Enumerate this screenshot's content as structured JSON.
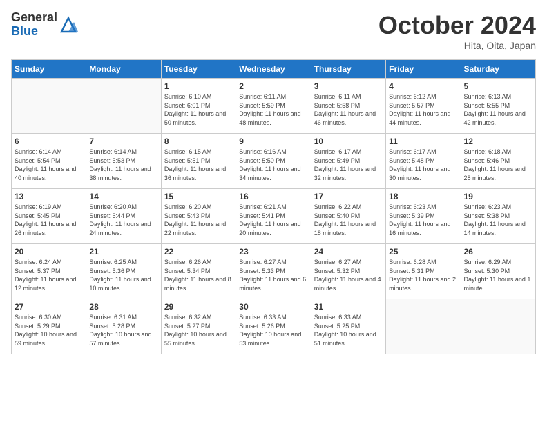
{
  "header": {
    "logo_general": "General",
    "logo_blue": "Blue",
    "month_title": "October 2024",
    "location": "Hita, Oita, Japan"
  },
  "days_of_week": [
    "Sunday",
    "Monday",
    "Tuesday",
    "Wednesday",
    "Thursday",
    "Friday",
    "Saturday"
  ],
  "weeks": [
    [
      {
        "day": "",
        "info": ""
      },
      {
        "day": "",
        "info": ""
      },
      {
        "day": "1",
        "info": "Sunrise: 6:10 AM\nSunset: 6:01 PM\nDaylight: 11 hours and 50 minutes."
      },
      {
        "day": "2",
        "info": "Sunrise: 6:11 AM\nSunset: 5:59 PM\nDaylight: 11 hours and 48 minutes."
      },
      {
        "day": "3",
        "info": "Sunrise: 6:11 AM\nSunset: 5:58 PM\nDaylight: 11 hours and 46 minutes."
      },
      {
        "day": "4",
        "info": "Sunrise: 6:12 AM\nSunset: 5:57 PM\nDaylight: 11 hours and 44 minutes."
      },
      {
        "day": "5",
        "info": "Sunrise: 6:13 AM\nSunset: 5:55 PM\nDaylight: 11 hours and 42 minutes."
      }
    ],
    [
      {
        "day": "6",
        "info": "Sunrise: 6:14 AM\nSunset: 5:54 PM\nDaylight: 11 hours and 40 minutes."
      },
      {
        "day": "7",
        "info": "Sunrise: 6:14 AM\nSunset: 5:53 PM\nDaylight: 11 hours and 38 minutes."
      },
      {
        "day": "8",
        "info": "Sunrise: 6:15 AM\nSunset: 5:51 PM\nDaylight: 11 hours and 36 minutes."
      },
      {
        "day": "9",
        "info": "Sunrise: 6:16 AM\nSunset: 5:50 PM\nDaylight: 11 hours and 34 minutes."
      },
      {
        "day": "10",
        "info": "Sunrise: 6:17 AM\nSunset: 5:49 PM\nDaylight: 11 hours and 32 minutes."
      },
      {
        "day": "11",
        "info": "Sunrise: 6:17 AM\nSunset: 5:48 PM\nDaylight: 11 hours and 30 minutes."
      },
      {
        "day": "12",
        "info": "Sunrise: 6:18 AM\nSunset: 5:46 PM\nDaylight: 11 hours and 28 minutes."
      }
    ],
    [
      {
        "day": "13",
        "info": "Sunrise: 6:19 AM\nSunset: 5:45 PM\nDaylight: 11 hours and 26 minutes."
      },
      {
        "day": "14",
        "info": "Sunrise: 6:20 AM\nSunset: 5:44 PM\nDaylight: 11 hours and 24 minutes."
      },
      {
        "day": "15",
        "info": "Sunrise: 6:20 AM\nSunset: 5:43 PM\nDaylight: 11 hours and 22 minutes."
      },
      {
        "day": "16",
        "info": "Sunrise: 6:21 AM\nSunset: 5:41 PM\nDaylight: 11 hours and 20 minutes."
      },
      {
        "day": "17",
        "info": "Sunrise: 6:22 AM\nSunset: 5:40 PM\nDaylight: 11 hours and 18 minutes."
      },
      {
        "day": "18",
        "info": "Sunrise: 6:23 AM\nSunset: 5:39 PM\nDaylight: 11 hours and 16 minutes."
      },
      {
        "day": "19",
        "info": "Sunrise: 6:23 AM\nSunset: 5:38 PM\nDaylight: 11 hours and 14 minutes."
      }
    ],
    [
      {
        "day": "20",
        "info": "Sunrise: 6:24 AM\nSunset: 5:37 PM\nDaylight: 11 hours and 12 minutes."
      },
      {
        "day": "21",
        "info": "Sunrise: 6:25 AM\nSunset: 5:36 PM\nDaylight: 11 hours and 10 minutes."
      },
      {
        "day": "22",
        "info": "Sunrise: 6:26 AM\nSunset: 5:34 PM\nDaylight: 11 hours and 8 minutes."
      },
      {
        "day": "23",
        "info": "Sunrise: 6:27 AM\nSunset: 5:33 PM\nDaylight: 11 hours and 6 minutes."
      },
      {
        "day": "24",
        "info": "Sunrise: 6:27 AM\nSunset: 5:32 PM\nDaylight: 11 hours and 4 minutes."
      },
      {
        "day": "25",
        "info": "Sunrise: 6:28 AM\nSunset: 5:31 PM\nDaylight: 11 hours and 2 minutes."
      },
      {
        "day": "26",
        "info": "Sunrise: 6:29 AM\nSunset: 5:30 PM\nDaylight: 11 hours and 1 minute."
      }
    ],
    [
      {
        "day": "27",
        "info": "Sunrise: 6:30 AM\nSunset: 5:29 PM\nDaylight: 10 hours and 59 minutes."
      },
      {
        "day": "28",
        "info": "Sunrise: 6:31 AM\nSunset: 5:28 PM\nDaylight: 10 hours and 57 minutes."
      },
      {
        "day": "29",
        "info": "Sunrise: 6:32 AM\nSunset: 5:27 PM\nDaylight: 10 hours and 55 minutes."
      },
      {
        "day": "30",
        "info": "Sunrise: 6:33 AM\nSunset: 5:26 PM\nDaylight: 10 hours and 53 minutes."
      },
      {
        "day": "31",
        "info": "Sunrise: 6:33 AM\nSunset: 5:25 PM\nDaylight: 10 hours and 51 minutes."
      },
      {
        "day": "",
        "info": ""
      },
      {
        "day": "",
        "info": ""
      }
    ]
  ]
}
